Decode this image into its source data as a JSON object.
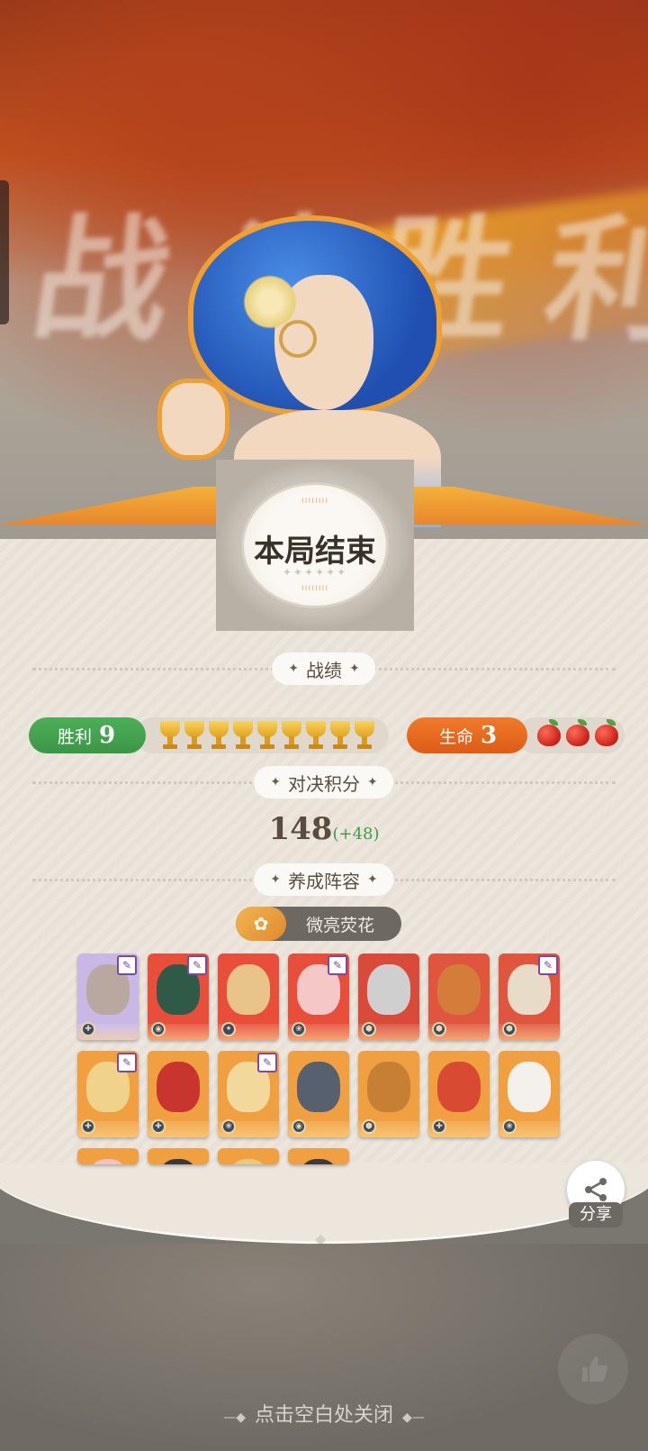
{
  "background_title": "战斗胜利",
  "result_badge": {
    "title": "本局结束"
  },
  "sections": {
    "record": "战绩",
    "score": "对决积分",
    "lineup": "养成阵容"
  },
  "stats": {
    "win_label": "胜利",
    "win_count": "9",
    "trophies": 9,
    "life_label": "生命",
    "life_count": "3",
    "apples": 3
  },
  "score": {
    "value": "148",
    "delta": "(+48)"
  },
  "synergy": {
    "label": "微亮荧花",
    "icon": "flower-sparkle-icon"
  },
  "heroes": [
    {
      "row": 0,
      "col": 0,
      "bg": "#c9b7e6",
      "face": "#b8a8a0",
      "item": true,
      "class_icon": "fighter-icon"
    },
    {
      "row": 0,
      "col": 1,
      "bg": "#e84e3a",
      "face": "#2f5a48",
      "item": true,
      "class_icon": "mage-icon"
    },
    {
      "row": 0,
      "col": 2,
      "bg": "#e84e3a",
      "face": "#e9c48a",
      "item": false,
      "class_icon": "support-icon"
    },
    {
      "row": 0,
      "col": 3,
      "bg": "#e84e3a",
      "face": "#f5c8c8",
      "item": true,
      "class_icon": "healer-icon"
    },
    {
      "row": 0,
      "col": 4,
      "bg": "#d94a3a",
      "face": "#d0cfcf",
      "item": false,
      "class_icon": "tank-icon"
    },
    {
      "row": 0,
      "col": 5,
      "bg": "#e0553e",
      "face": "#d47d3a",
      "item": false,
      "class_icon": "tank-icon"
    },
    {
      "row": 0,
      "col": 6,
      "bg": "#e0553e",
      "face": "#e8dcc8",
      "item": true,
      "class_icon": "tank-icon"
    },
    {
      "row": 1,
      "col": 0,
      "bg": "#f0a040",
      "face": "#f0d28a",
      "item": true,
      "class_icon": "fighter-icon"
    },
    {
      "row": 1,
      "col": 1,
      "bg": "#f0a040",
      "face": "#c8342e",
      "item": false,
      "class_icon": "fighter-icon"
    },
    {
      "row": 1,
      "col": 2,
      "bg": "#f0a040",
      "face": "#f2d89a",
      "item": true,
      "class_icon": "healer-icon"
    },
    {
      "row": 1,
      "col": 3,
      "bg": "#f0a040",
      "face": "#56606e",
      "item": false,
      "class_icon": "mage-icon"
    },
    {
      "row": 1,
      "col": 4,
      "bg": "#f0a040",
      "face": "#c77f34",
      "item": false,
      "class_icon": "tank-icon"
    },
    {
      "row": 1,
      "col": 5,
      "bg": "#f0a040",
      "face": "#d84a32",
      "item": false,
      "class_icon": "fighter-icon"
    },
    {
      "row": 1,
      "col": 6,
      "bg": "#f0a040",
      "face": "#f4f1ec",
      "item": false,
      "class_icon": "healer-icon"
    },
    {
      "row": 2,
      "col": 0,
      "bg": "#f0a040",
      "face": "#f2c2c2",
      "item": false,
      "class_icon": "",
      "partial": true
    },
    {
      "row": 2,
      "col": 1,
      "bg": "#f0a040",
      "face": "#3a3a3a",
      "item": false,
      "class_icon": "",
      "partial": true
    },
    {
      "row": 2,
      "col": 2,
      "bg": "#f0a040",
      "face": "#e8c880",
      "item": false,
      "class_icon": "",
      "partial": true
    },
    {
      "row": 2,
      "col": 3,
      "bg": "#f0a040",
      "face": "#3c3a40",
      "item": false,
      "class_icon": "",
      "partial": true
    }
  ],
  "share": {
    "label": "分享",
    "icon": "share-icon"
  },
  "close_hint": "点击空白处关闭",
  "colors": {
    "win_green": "#3b9647",
    "life_orange": "#de5b17",
    "score_delta_green": "#3f9a4a",
    "panel_cream": "#ece6dd"
  }
}
